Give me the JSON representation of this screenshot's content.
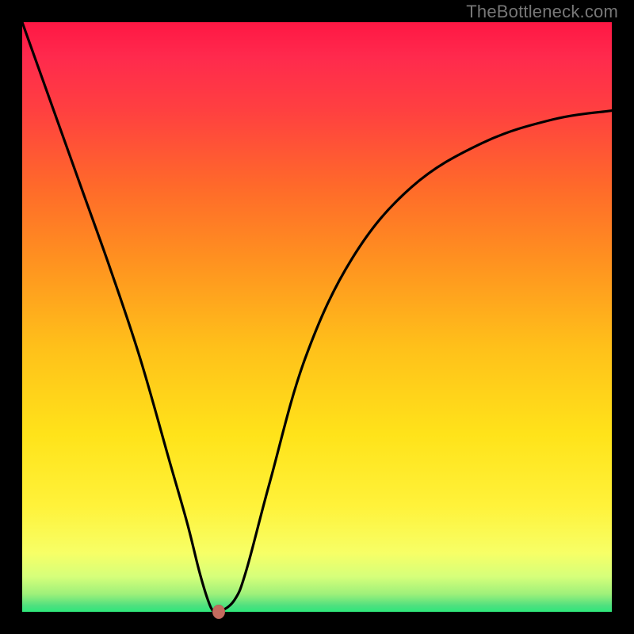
{
  "watermark": "TheBottleneck.com",
  "chart_data": {
    "type": "line",
    "title": "",
    "xlabel": "",
    "ylabel": "",
    "xlim": [
      0,
      1
    ],
    "ylim": [
      0,
      1
    ],
    "series": [
      {
        "name": "bottleneck-curve",
        "x": [
          0.0,
          0.05,
          0.1,
          0.15,
          0.2,
          0.25,
          0.28,
          0.3,
          0.315,
          0.325,
          0.335,
          0.36,
          0.38,
          0.42,
          0.48,
          0.56,
          0.66,
          0.78,
          0.9,
          1.0
        ],
        "values": [
          1.0,
          0.86,
          0.72,
          0.58,
          0.43,
          0.255,
          0.15,
          0.07,
          0.02,
          0.0,
          0.0,
          0.02,
          0.07,
          0.22,
          0.43,
          0.6,
          0.72,
          0.795,
          0.835,
          0.85
        ]
      }
    ],
    "marker": {
      "x": 0.333,
      "y": 0.0
    },
    "gradient_stops": [
      {
        "pos": 0.0,
        "color": "#ff1744"
      },
      {
        "pos": 0.5,
        "color": "#ffd61a"
      },
      {
        "pos": 0.92,
        "color": "#f7ff66"
      },
      {
        "pos": 1.0,
        "color": "#2ee87b"
      }
    ]
  }
}
